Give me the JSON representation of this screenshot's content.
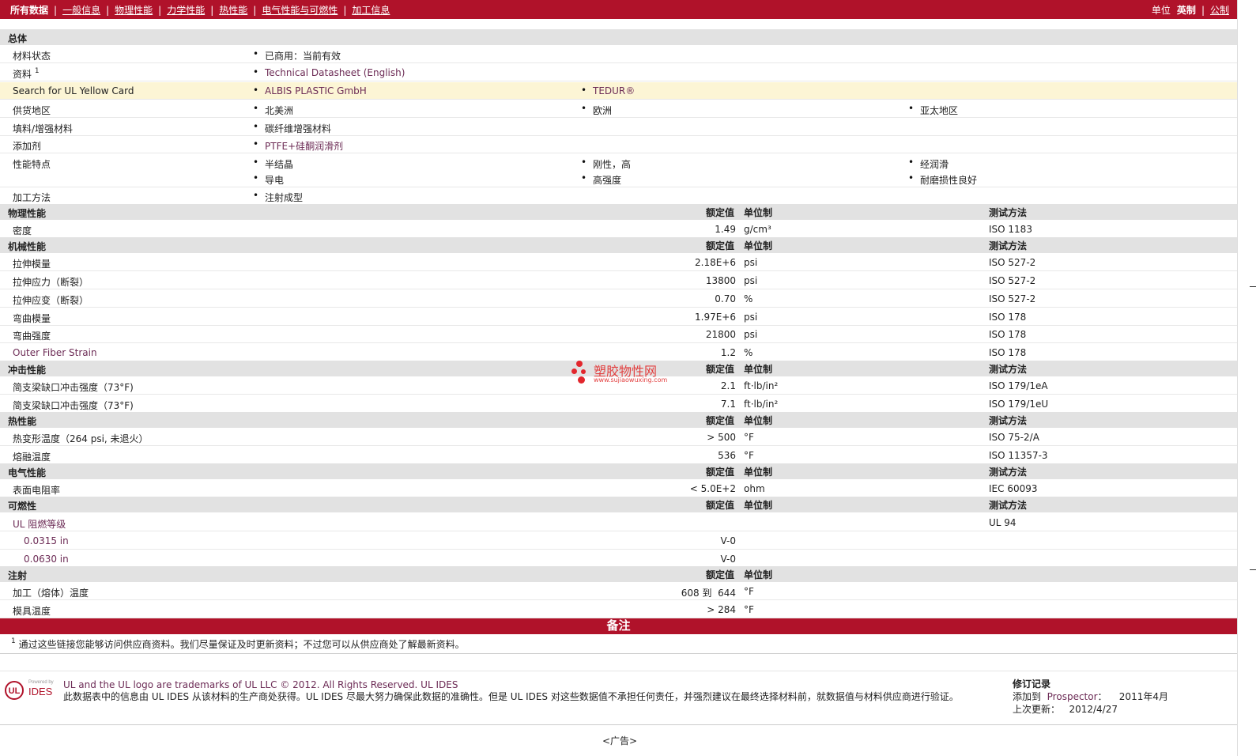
{
  "nav": {
    "all": "所有数据",
    "items": [
      "一般信息",
      "物理性能",
      "力学性能",
      "热性能",
      "电气性能与可燃性",
      "加工信息"
    ],
    "unit_label": "单位",
    "imperial": "英制",
    "metric": "公制"
  },
  "general": {
    "title": "总体",
    "rows": {
      "status_label": "材料状态",
      "status_value": "已商用：当前有效",
      "doc_label": "资料",
      "doc_sup": "1",
      "doc_value": "Technical Datasheet (English)",
      "ul_label": "Search for UL Yellow Card",
      "ul_v1": "ALBIS PLASTIC GmbH",
      "ul_v2": "TEDUR®",
      "supply_label": "供货地区",
      "supply_v1": "北美洲",
      "supply_v2": "欧洲",
      "supply_v3": "亚太地区",
      "filler_label": "填料/增强材料",
      "filler_value": "碳纤维增强材料",
      "additive_label": "添加剂",
      "additive_value": "PTFE+硅酮润滑剂",
      "features_label": "性能特点",
      "features": [
        "半结晶",
        "刚性，高",
        "经润滑",
        "导电",
        "高强度",
        "耐磨损性良好"
      ],
      "process_label": "加工方法",
      "process_value": "注射成型"
    }
  },
  "headers": {
    "nominal": "额定值",
    "unit": "单位制",
    "method": "测试方法"
  },
  "physical": {
    "title": "物理性能",
    "rows": [
      {
        "name": "密度",
        "value": "1.49",
        "unit": "g/cm³",
        "method": "ISO 1183"
      }
    ]
  },
  "mechanical": {
    "title": "机械性能",
    "rows": [
      {
        "name": "拉伸模量",
        "value": "2.18E+6",
        "unit": "psi",
        "method": "ISO 527-2"
      },
      {
        "name": "拉伸应力（断裂）",
        "value": "13800",
        "unit": "psi",
        "method": "ISO 527-2"
      },
      {
        "name": "拉伸应变（断裂）",
        "value": "0.70",
        "unit": "%",
        "method": "ISO 527-2"
      },
      {
        "name": "弯曲模量",
        "value": "1.97E+6",
        "unit": "psi",
        "method": "ISO 178"
      },
      {
        "name": "弯曲强度",
        "value": "21800",
        "unit": "psi",
        "method": "ISO 178"
      },
      {
        "name": "Outer Fiber Strain",
        "value": "1.2",
        "unit": "%",
        "method": "ISO 178"
      }
    ]
  },
  "impact": {
    "title": "冲击性能",
    "rows": [
      {
        "name": "简支梁缺口冲击强度（73°F)",
        "value": "2.1",
        "unit": "ft·lb/in²",
        "method": "ISO 179/1eA"
      },
      {
        "name": "简支梁缺口冲击强度（73°F)",
        "value": "7.1",
        "unit": "ft·lb/in²",
        "method": "ISO 179/1eU"
      }
    ]
  },
  "thermal": {
    "title": "热性能",
    "rows": [
      {
        "name": "热变形温度（264 psi, 未退火）",
        "value": "> 500",
        "unit": "°F",
        "method": "ISO 75-2/A"
      },
      {
        "name": "熔融温度",
        "value": "536",
        "unit": "°F",
        "method": "ISO 11357-3"
      }
    ]
  },
  "electrical": {
    "title": "电气性能",
    "rows": [
      {
        "name": "表面电阻率",
        "value": "< 5.0E+2",
        "unit": "ohm",
        "method": "IEC 60093"
      }
    ]
  },
  "flammability": {
    "title": "可燃性",
    "main": {
      "name": "UL 阻燃等级",
      "method": "UL 94"
    },
    "sub": [
      {
        "name": "0.0315 in",
        "value": "V-0"
      },
      {
        "name": "0.0630 in",
        "value": "V-0"
      }
    ]
  },
  "injection": {
    "title": "注射",
    "rows": [
      {
        "name": "加工（熔体）温度",
        "value": "608 到  644",
        "unit": "°F"
      },
      {
        "name": "模具温度",
        "value": "> 284",
        "unit": "°F"
      }
    ]
  },
  "notes": {
    "title": "备注",
    "sup": "1",
    "text": "通过这些链接您能够访问供应商资料。我们尽量保证及时更新资料；不过您可以从供应商处了解最新资料。"
  },
  "footer": {
    "logo_small": "Powered by",
    "logo_text": "IDES",
    "line1": "UL and the UL logo are trademarks of UL LLC © 2012. All Rights Reserved. UL IDES",
    "line2": "此数据表中的信息由 UL IDES 从该材料的生产商处获得。UL IDES 尽最大努力确保此数据的准确性。但是 UL IDES 对这些数据值不承担任何责任，并强烈建议在最终选择材料前，就数据值与材料供应商进行验证。",
    "rev_title": "修订记录",
    "added_label": "添加到",
    "added_link": "Prospector",
    "added_date": "2011年4月",
    "updated_label": "上次更新：",
    "updated_date": "2012/4/27",
    "ad": "<广告>"
  },
  "watermark": {
    "cn": "塑胶物性网",
    "url": "www.sujiaowuxing.com"
  },
  "colors": {
    "brand": "#b0122a",
    "link": "#6c2b55",
    "section_bg": "#e2e2e2",
    "highlight": "#fcf5d5"
  }
}
